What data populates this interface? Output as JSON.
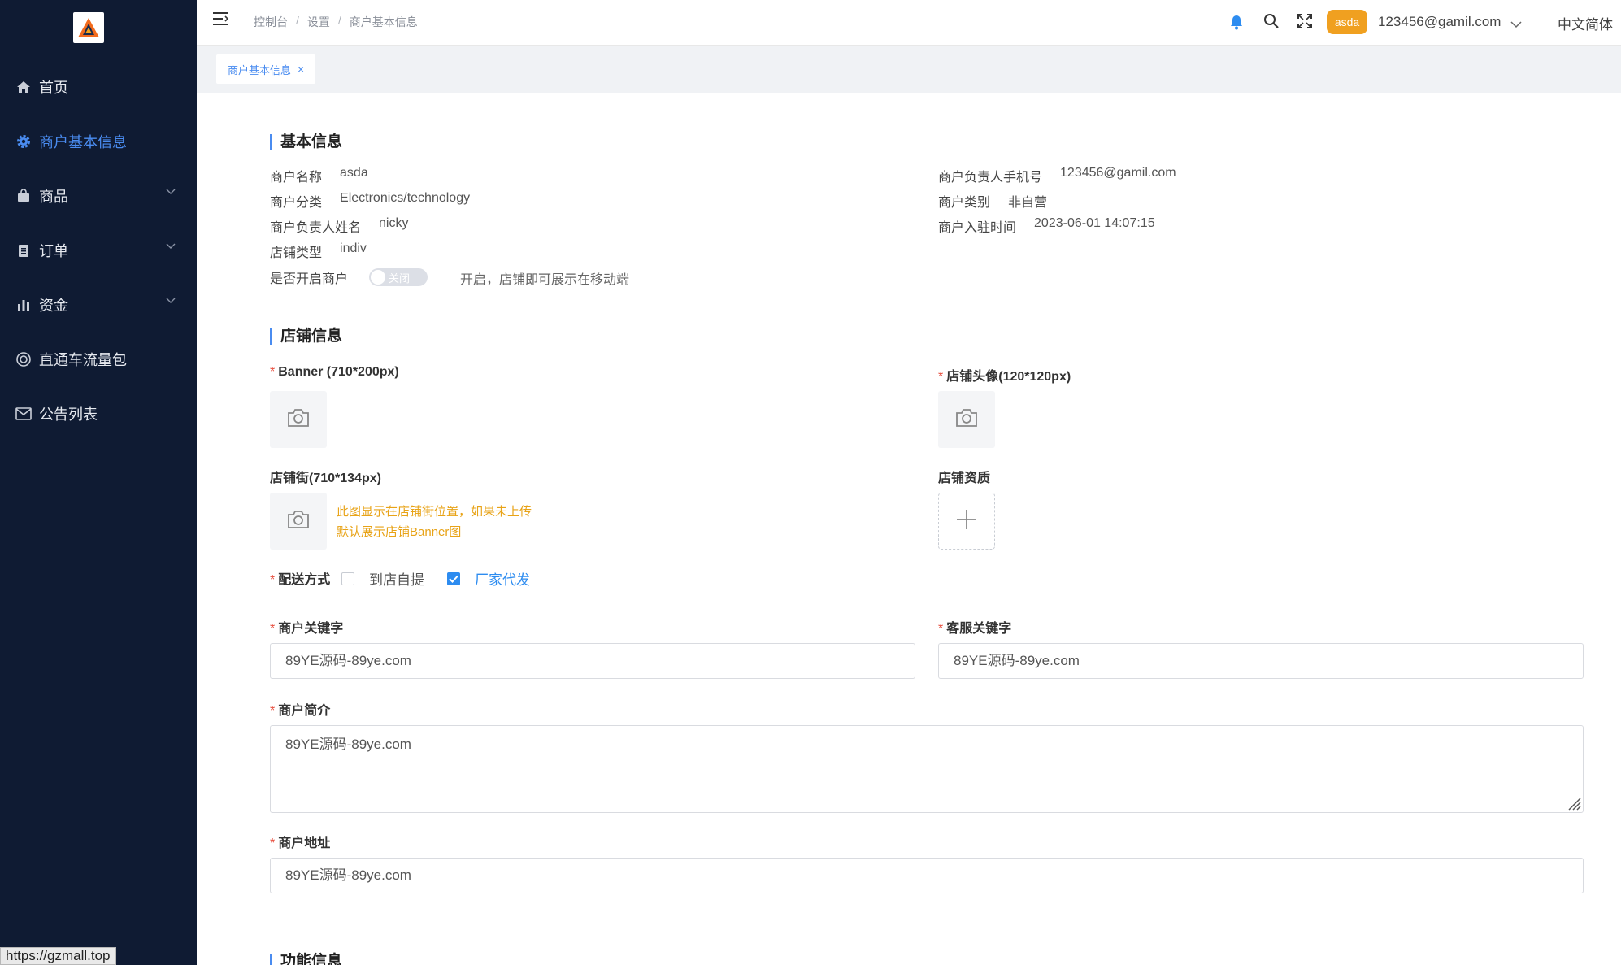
{
  "sidebar": {
    "items": [
      {
        "label": "首页",
        "icon": "home-icon"
      },
      {
        "label": "商户基本信息",
        "icon": "gear-icon",
        "active": true
      },
      {
        "label": "商品",
        "icon": "bag-icon",
        "expandable": true
      },
      {
        "label": "订单",
        "icon": "clipboard-icon",
        "expandable": true
      },
      {
        "label": "资金",
        "icon": "bar-chart-icon",
        "expandable": true
      },
      {
        "label": "直通车流量包",
        "icon": "lifebuoy-icon"
      },
      {
        "label": "公告列表",
        "icon": "mail-icon"
      }
    ],
    "status_url": "https://gzmall.top"
  },
  "header": {
    "breadcrumb": [
      "控制台",
      "设置",
      "商户基本信息"
    ],
    "avatar_label": "asda",
    "user_email": "123456@gamil.com",
    "language": "中文简体"
  },
  "tabs": [
    {
      "label": "商户基本信息",
      "closable": true
    }
  ],
  "basic": {
    "title": "基本信息",
    "name_label": "商户名称",
    "name_value": "asda",
    "category_label": "商户分类",
    "category_value": "Electronics/technology",
    "owner_label": "商户负责人姓名",
    "owner_value": "nicky",
    "store_type_label": "店铺类型",
    "store_type_value": "indiv",
    "open_label": "是否开启商户",
    "open_switch_text": "关闭",
    "open_switch_on": false,
    "open_hint": "开启，店铺即可展示在移动端",
    "phone_label": "商户负责人手机号",
    "phone_value": "123456@gamil.com",
    "kind_label": "商户类别",
    "kind_value": "非自营",
    "joined_label": "商户入驻时间",
    "joined_value": "2023-06-01 14:07:15"
  },
  "store": {
    "title": "店铺信息",
    "banner_label": "Banner (710*200px)",
    "avatar_label": "店铺头像(120*120px)",
    "street_label": "店铺街(710*134px)",
    "street_note_line1": "此图显示在店铺街位置，如果未上传",
    "street_note_line2": "默认展示店铺Banner图",
    "qualification_label": "店铺资质",
    "delivery_label": "配送方式",
    "delivery_options": [
      {
        "label": "到店自提",
        "checked": false
      },
      {
        "label": "厂家代发",
        "checked": true
      }
    ],
    "keyword_label": "商户关键字",
    "keyword_value": "89YE源码-89ye.com",
    "service_keyword_label": "客服关键字",
    "service_keyword_value": "89YE源码-89ye.com",
    "intro_label": "商户简介",
    "intro_value": "89YE源码-89ye.com",
    "address_label": "商户地址",
    "address_value": "89YE源码-89ye.com"
  },
  "function": {
    "title": "功能信息"
  },
  "colors": {
    "sidebar_bg": "#0f1b33",
    "accent": "#4a8cf0",
    "badge": "#f0a020",
    "note": "#e8a317",
    "required": "#e74c3c"
  }
}
